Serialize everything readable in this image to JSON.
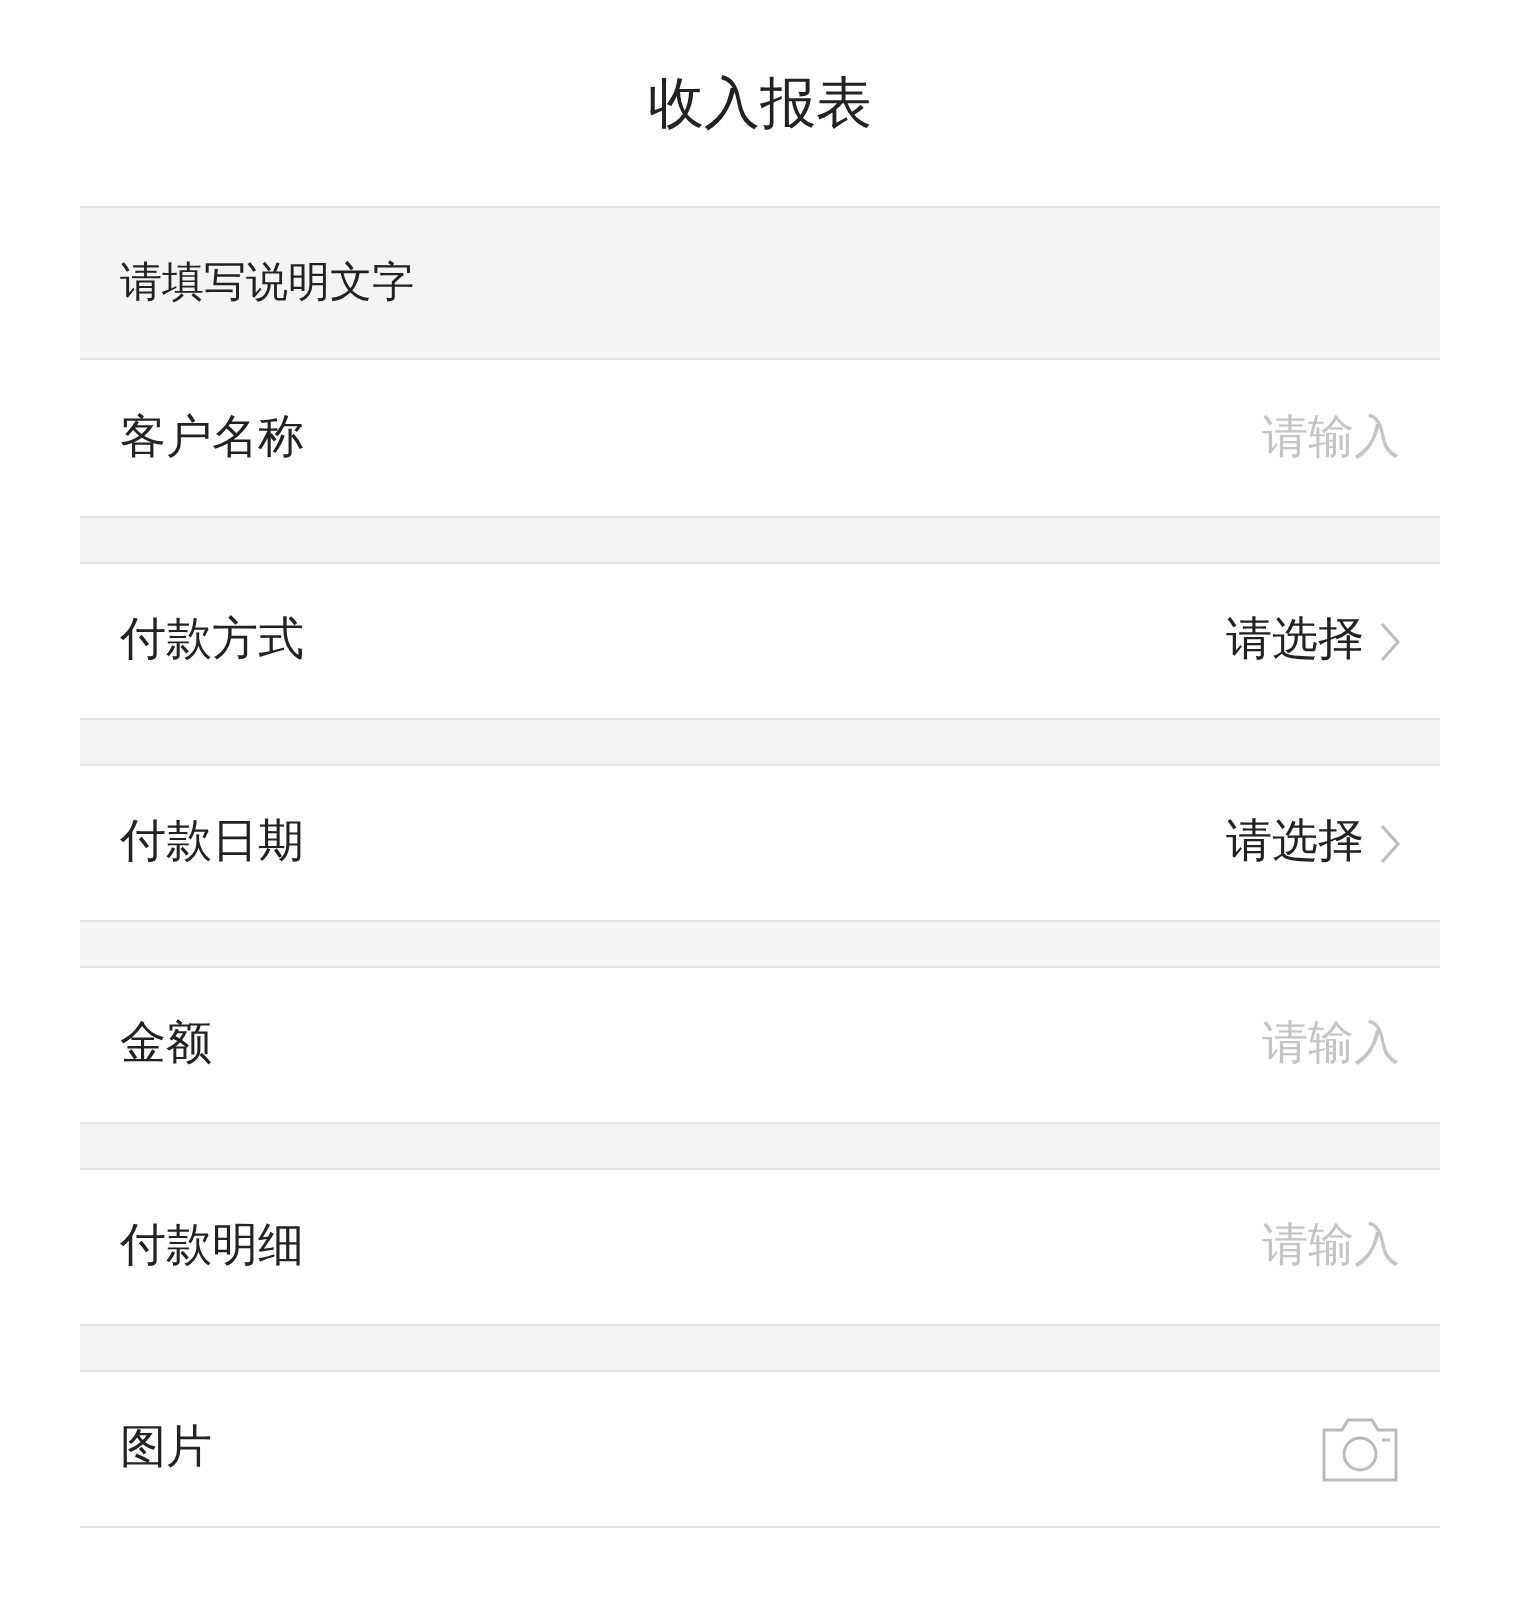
{
  "title": "收入报表",
  "description": "请填写说明文字",
  "fields": [
    {
      "kind": "input",
      "label": "客户名称",
      "placeholder": "请输入"
    },
    {
      "kind": "select",
      "label": "付款方式",
      "value": "请选择"
    },
    {
      "kind": "select",
      "label": "付款日期",
      "value": "请选择"
    },
    {
      "kind": "input",
      "label": "金额",
      "placeholder": "请输入"
    },
    {
      "kind": "input",
      "label": "付款明细",
      "placeholder": "请输入"
    },
    {
      "kind": "photo",
      "label": "图片"
    }
  ]
}
